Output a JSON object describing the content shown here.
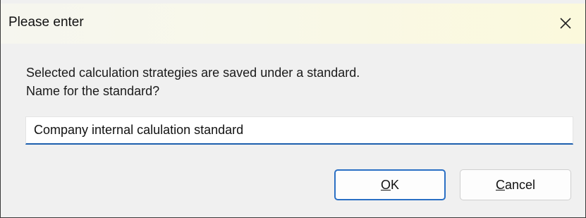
{
  "dialog": {
    "title": "Please enter",
    "close_icon": "close-icon",
    "message_line1": "Selected calculation strategies are saved under a standard.",
    "message_line2": "Name for the standard?",
    "input_value": "Company internal calulation standard",
    "ok_label_accel": "O",
    "ok_label_rest": "K",
    "cancel_label_accel": "C",
    "cancel_label_rest": "ancel",
    "colors": {
      "accent": "#2a6fc4",
      "input_underline": "#1d5fae",
      "titlebar_tint": "#fbf9dc",
      "background": "#f0f0f0"
    }
  }
}
